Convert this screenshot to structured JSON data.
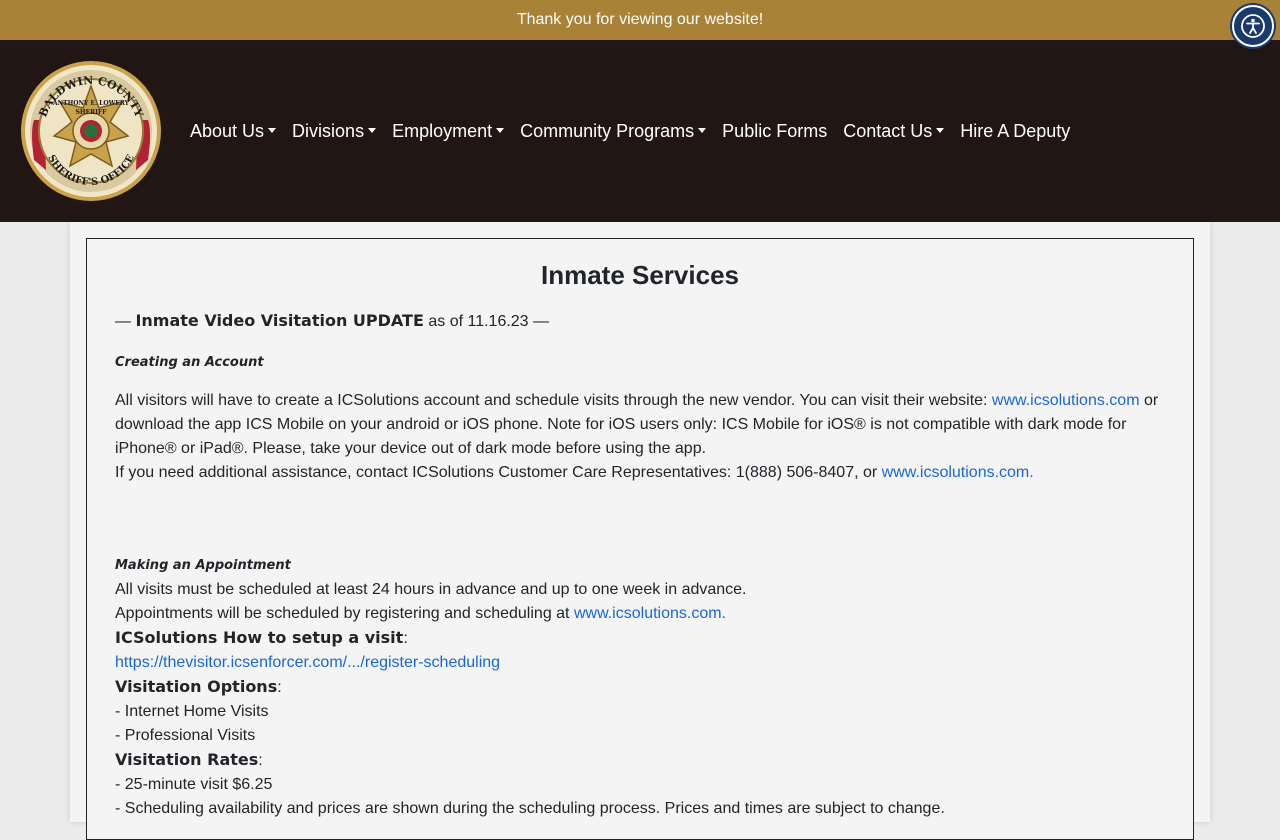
{
  "topbar": {
    "message": "Thank you for viewing our website!"
  },
  "accessibility": {
    "icon": "accessibility-icon"
  },
  "logo": {
    "top_text": "BALDWIN COUNTY",
    "name_text": "ANTHONY E. LOWERY",
    "rank_text": "SHERIFF",
    "bottom_text": "SHERIFF'S OFFICE"
  },
  "nav": {
    "items": [
      {
        "label": "About Us",
        "dropdown": true
      },
      {
        "label": "Divisions",
        "dropdown": true
      },
      {
        "label": "Employment",
        "dropdown": true
      },
      {
        "label": "Community Programs",
        "dropdown": true
      },
      {
        "label": "Public Forms",
        "dropdown": false
      },
      {
        "label": "Contact Us",
        "dropdown": true
      },
      {
        "label": "Hire A Deputy",
        "dropdown": false
      }
    ]
  },
  "main": {
    "title": "Inmate Services",
    "update_prefix": "— ",
    "update_bold": "Inmate Video Visitation UPDATE",
    "update_suffix": " as of 11.16.23 —",
    "creating_heading": "Creating an Account",
    "creating_p1_a": "All visitors will have to create a ICSolutions account and schedule visits through the new vendor. You can visit their website: ",
    "creating_p1_link": "www.icsolutions.com",
    "creating_p1_b": " or download the app ICS Mobile on your android or iOS phone. Note for iOS users only: ICS Mobile for iOS® is not compatible with dark mode for iPhone® or iPad®. Please, take your device out of dark mode before using the app.",
    "creating_p2_a": "If you need additional assistance, contact ICSolutions Customer Care Representatives: 1(888) 506-8407, or ",
    "creating_p2_link": "www.icsolutions.com.",
    "appointment_heading": "Making an Appointment",
    "appointment_line1": "All visits must be scheduled at least 24 hours in advance and up to one week in advance.",
    "appointment_line2_a": "Appointments will be scheduled by registering and scheduling at ",
    "appointment_line2_link": "www.icsolutions.com.",
    "setup_label": "ICSolutions How to setup a visit",
    "setup_link": "https://thevisitor.icsenforcer.com/.../register-scheduling",
    "options_label": "Visitation Options",
    "option_1": "- Internet Home Visits",
    "option_2": "- Professional Visits",
    "rates_label": "Visitation Rates",
    "rate_1": "- 25-minute visit $6.25",
    "rate_2": "- Scheduling availability and prices are shown during the scheduling process. Prices and times are subject to change."
  }
}
